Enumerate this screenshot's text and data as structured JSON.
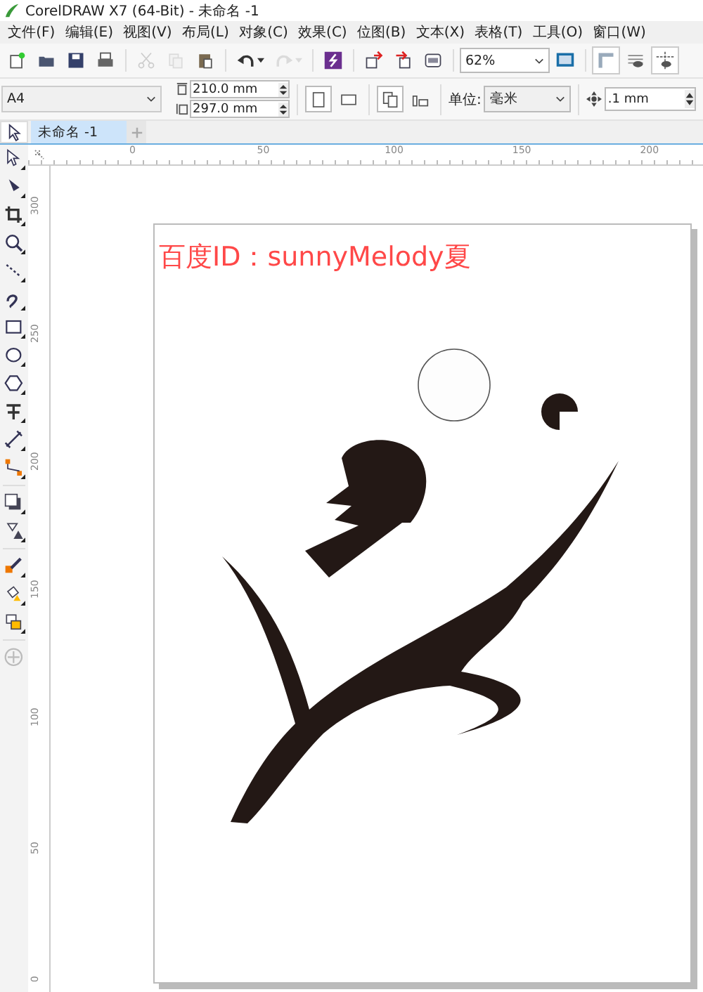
{
  "window": {
    "title": "CorelDRAW X7 (64-Bit) - 未命名 -1"
  },
  "menu": [
    "文件(F)",
    "编辑(E)",
    "视图(V)",
    "布局(L)",
    "对象(C)",
    "效果(C)",
    "位图(B)",
    "文本(X)",
    "表格(T)",
    "工具(O)",
    "窗口(W)"
  ],
  "toolbar": [
    {
      "kind": "new",
      "disabled": false
    },
    {
      "kind": "open",
      "disabled": false
    },
    {
      "kind": "save",
      "disabled": false
    },
    {
      "kind": "print",
      "disabled": false
    },
    {
      "kind": "sep"
    },
    {
      "kind": "cut",
      "disabled": true
    },
    {
      "kind": "copy",
      "disabled": true
    },
    {
      "kind": "paste",
      "disabled": false
    },
    {
      "kind": "sep"
    },
    {
      "kind": "undo",
      "disabled": false
    },
    {
      "kind": "redo",
      "disabled": true
    },
    {
      "kind": "sep"
    },
    {
      "kind": "launcher",
      "disabled": false
    },
    {
      "kind": "sep"
    },
    {
      "kind": "import",
      "disabled": false
    },
    {
      "kind": "export",
      "disabled": false
    },
    {
      "kind": "pdf",
      "disabled": false
    },
    {
      "kind": "sep"
    },
    {
      "kind": "zoom",
      "value": "62%"
    },
    {
      "kind": "fullscreen",
      "disabled": false
    },
    {
      "kind": "sep"
    },
    {
      "kind": "rulers",
      "disabled": false
    },
    {
      "kind": "grid",
      "disabled": false
    },
    {
      "kind": "guides",
      "disabled": false
    }
  ],
  "property_bar": {
    "page_size": "A4",
    "width": "210.0 mm",
    "height": "297.0 mm",
    "portrait_selected": true,
    "unit_label": "单位:",
    "unit": "毫米",
    "nudge": ".1 mm"
  },
  "tabs": [
    {
      "label": "未命名 -1",
      "selected": true
    }
  ],
  "ruler": {
    "horizontal": [
      "0",
      "50",
      "100",
      "150",
      "200"
    ],
    "vertical": [
      "300",
      "250",
      "200",
      "150",
      "100",
      "50",
      "0"
    ]
  },
  "toolbox": [
    {
      "kind": "pick"
    },
    {
      "kind": "shape"
    },
    {
      "kind": "crop"
    },
    {
      "kind": "zoom"
    },
    {
      "kind": "freehand"
    },
    {
      "kind": "artistic"
    },
    {
      "kind": "rectangle"
    },
    {
      "kind": "ellipse"
    },
    {
      "kind": "polygon"
    },
    {
      "kind": "text"
    },
    {
      "kind": "dimension"
    },
    {
      "kind": "connector"
    },
    {
      "kind": "sep"
    },
    {
      "kind": "shadow"
    },
    {
      "kind": "transparency"
    },
    {
      "kind": "sep"
    },
    {
      "kind": "eyedropper"
    },
    {
      "kind": "fill"
    },
    {
      "kind": "smartfill"
    },
    {
      "kind": "sep"
    },
    {
      "kind": "add"
    }
  ],
  "canvas": {
    "text": "百度ID：sunnyMelody夏"
  }
}
